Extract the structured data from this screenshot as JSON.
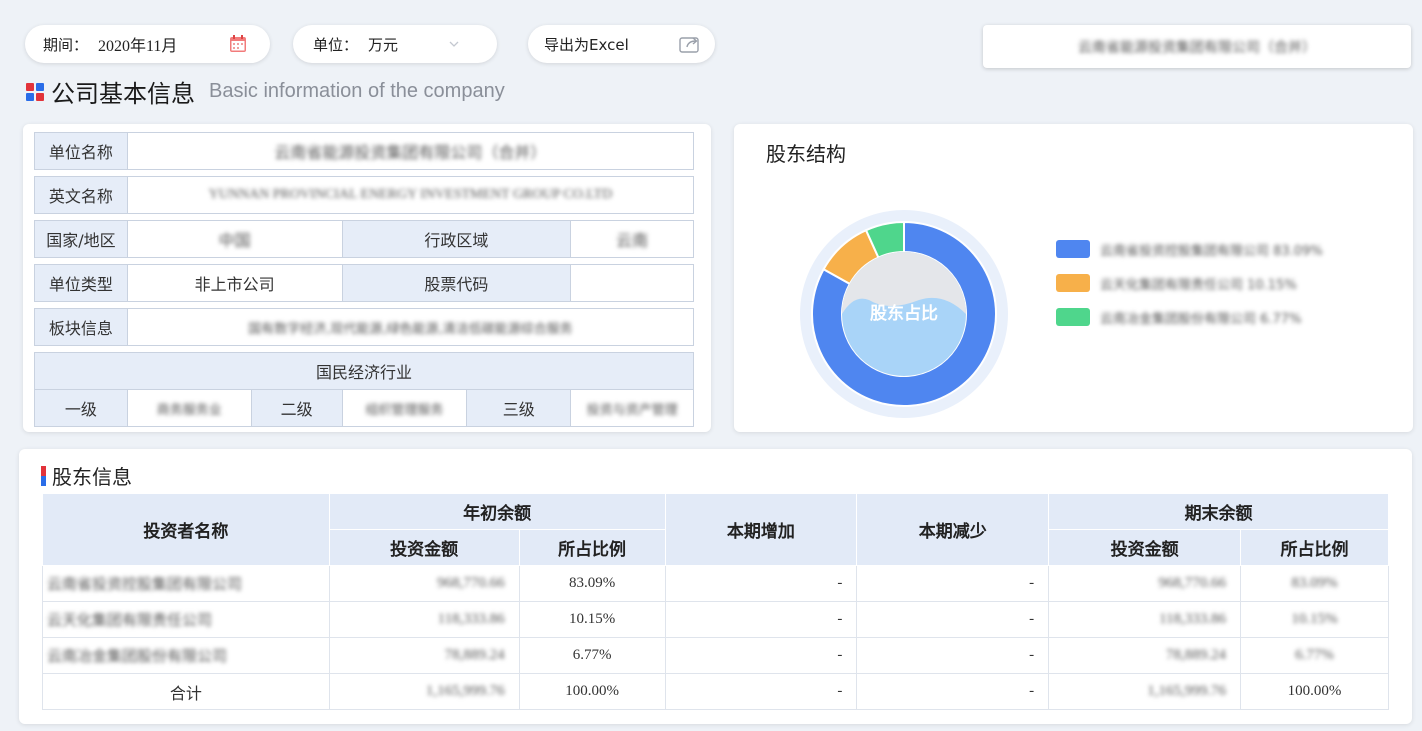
{
  "filters": {
    "period_label": "期间：",
    "period_value": "2020年11月",
    "unit_label": "单位：",
    "unit_value": "万元",
    "export_label": "导出为Excel",
    "top_right_text": "云南省能源投资集团有限公司（合并）"
  },
  "section": {
    "title_zh": "公司基本信息",
    "title_en": "Basic information of the company"
  },
  "info": {
    "unit_name_label": "单位名称",
    "unit_name_value": "云南省能源投资集团有限公司（合并）",
    "english_name_label": "英文名称",
    "english_name_value": "YUNNAN PROVINCIAL ENERGY INVESTMENT GROUP CO.LTD",
    "country_label": "国家/地区",
    "country_value": "中国",
    "admin_region_label": "行政区域",
    "admin_region_value": "云南",
    "unit_type_label": "单位类型",
    "unit_type_value": "非上市公司",
    "stock_code_label": "股票代码",
    "stock_code_value": "",
    "sector_label": "板块信息",
    "sector_value": "国有数字经济,现代能源,绿色能源,清洁低碳能源综合服务",
    "industry_header": "国民经济行业",
    "level1_label": "一级",
    "level1_value": "商务服务业",
    "level2_label": "二级",
    "level2_value": "组织管理服务",
    "level3_label": "三级",
    "level3_value": "投资与资产管理"
  },
  "holder_structure": {
    "title": "股东结构",
    "center_label": "股东占比",
    "legend": [
      {
        "name": "云南省投资控股集团有限公司 83.09%",
        "color": "#4f86f0"
      },
      {
        "name": "云天化集团有限责任公司 10.15%",
        "color": "#f7b04a"
      },
      {
        "name": "云南冶金集团股份有限公司 6.77%",
        "color": "#4fd68c"
      }
    ]
  },
  "chart_data": {
    "type": "pie",
    "categories": [
      "云南省投资控股集团有限公司",
      "云天化集团有限责任公司",
      "云南冶金集团股份有限公司"
    ],
    "values": [
      83.09,
      10.15,
      6.77
    ],
    "colors": [
      "#4f86f0",
      "#f7b04a",
      "#4fd68c"
    ],
    "title": "股东结构"
  },
  "shareholders": {
    "title": "股东信息",
    "headers": {
      "investor": "投资者名称",
      "begin": "年初余额",
      "increase": "本期增加",
      "decrease": "本期减少",
      "end": "期末余额",
      "amount": "投资金额",
      "ratio": "所占比例"
    },
    "rows": [
      {
        "name": "云南省投资控股集团有限公司",
        "begin_amount": "968,770.66",
        "begin_ratio": "83.09%",
        "increase": "-",
        "decrease": "-",
        "end_amount": "968,770.66",
        "end_ratio": "83.09%"
      },
      {
        "name": "云天化集团有限责任公司",
        "begin_amount": "118,333.86",
        "begin_ratio": "10.15%",
        "increase": "-",
        "decrease": "-",
        "end_amount": "118,333.86",
        "end_ratio": "10.15%"
      },
      {
        "name": "云南冶金集团股份有限公司",
        "begin_amount": "78,889.24",
        "begin_ratio": "6.77%",
        "increase": "-",
        "decrease": "-",
        "end_amount": "78,889.24",
        "end_ratio": "6.77%"
      }
    ],
    "total": {
      "name": "合计",
      "begin_amount": "1,165,999.76",
      "begin_ratio": "100.00%",
      "increase": "-",
      "decrease": "-",
      "end_amount": "1,165,999.76",
      "end_ratio": "100.00%"
    }
  }
}
